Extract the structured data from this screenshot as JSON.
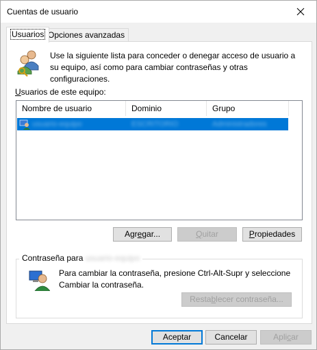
{
  "window": {
    "title": "Cuentas de usuario"
  },
  "tabs": [
    {
      "label": "Usuarios"
    },
    {
      "label": "Opciones avanzadas"
    }
  ],
  "description": "Use la siguiente lista para conceder o denegar acceso de usuario a su equipo, así como para cambiar contraseñas y otras configuraciones.",
  "list": {
    "label": "Usuarios de este equipo:",
    "columns": [
      "Nombre de usuario",
      "Dominio",
      "Grupo"
    ],
    "rows": [
      {
        "name": "usuario-equipo",
        "domain": "ESCRITORIO",
        "group": "Administradores"
      }
    ]
  },
  "buttons": {
    "add": "Agregar...",
    "remove": "Quitar",
    "properties": "Propiedades",
    "reset_password": "Restablecer contraseña...",
    "ok": "Aceptar",
    "cancel": "Cancelar",
    "apply": "Aplicar"
  },
  "password": {
    "legend": "Contraseña para",
    "user_blurred": "usuario-equipo",
    "text": "Para cambiar la contraseña, presione Ctrl-Alt-Supr y seleccione Cambiar la contraseña."
  },
  "colors": {
    "selection": "#0078d7",
    "accent_border": "#0078d7"
  },
  "icons": {
    "close": "close-icon",
    "users": "users-icon",
    "user_row": "user-row-icon",
    "password": "password-user-icon"
  }
}
